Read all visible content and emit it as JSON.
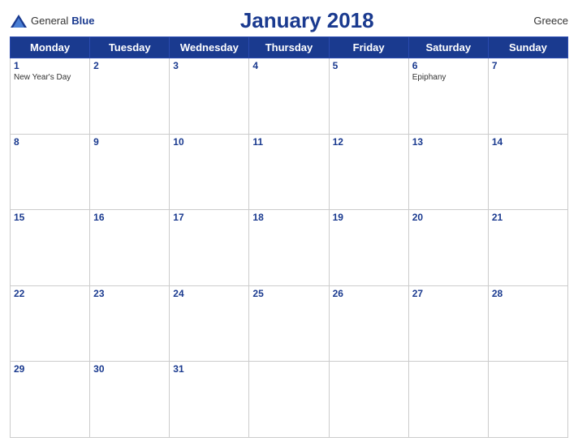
{
  "logo": {
    "general": "General",
    "blue": "Blue"
  },
  "header": {
    "title": "January 2018",
    "country": "Greece"
  },
  "weekdays": [
    "Monday",
    "Tuesday",
    "Wednesday",
    "Thursday",
    "Friday",
    "Saturday",
    "Sunday"
  ],
  "weeks": [
    [
      {
        "day": 1,
        "holiday": "New Year's Day"
      },
      {
        "day": 2,
        "holiday": ""
      },
      {
        "day": 3,
        "holiday": ""
      },
      {
        "day": 4,
        "holiday": ""
      },
      {
        "day": 5,
        "holiday": ""
      },
      {
        "day": 6,
        "holiday": "Epiphany"
      },
      {
        "day": 7,
        "holiday": ""
      }
    ],
    [
      {
        "day": 8,
        "holiday": ""
      },
      {
        "day": 9,
        "holiday": ""
      },
      {
        "day": 10,
        "holiday": ""
      },
      {
        "day": 11,
        "holiday": ""
      },
      {
        "day": 12,
        "holiday": ""
      },
      {
        "day": 13,
        "holiday": ""
      },
      {
        "day": 14,
        "holiday": ""
      }
    ],
    [
      {
        "day": 15,
        "holiday": ""
      },
      {
        "day": 16,
        "holiday": ""
      },
      {
        "day": 17,
        "holiday": ""
      },
      {
        "day": 18,
        "holiday": ""
      },
      {
        "day": 19,
        "holiday": ""
      },
      {
        "day": 20,
        "holiday": ""
      },
      {
        "day": 21,
        "holiday": ""
      }
    ],
    [
      {
        "day": 22,
        "holiday": ""
      },
      {
        "day": 23,
        "holiday": ""
      },
      {
        "day": 24,
        "holiday": ""
      },
      {
        "day": 25,
        "holiday": ""
      },
      {
        "day": 26,
        "holiday": ""
      },
      {
        "day": 27,
        "holiday": ""
      },
      {
        "day": 28,
        "holiday": ""
      }
    ],
    [
      {
        "day": 29,
        "holiday": ""
      },
      {
        "day": 30,
        "holiday": ""
      },
      {
        "day": 31,
        "holiday": ""
      },
      {
        "day": null,
        "holiday": ""
      },
      {
        "day": null,
        "holiday": ""
      },
      {
        "day": null,
        "holiday": ""
      },
      {
        "day": null,
        "holiday": ""
      }
    ]
  ]
}
